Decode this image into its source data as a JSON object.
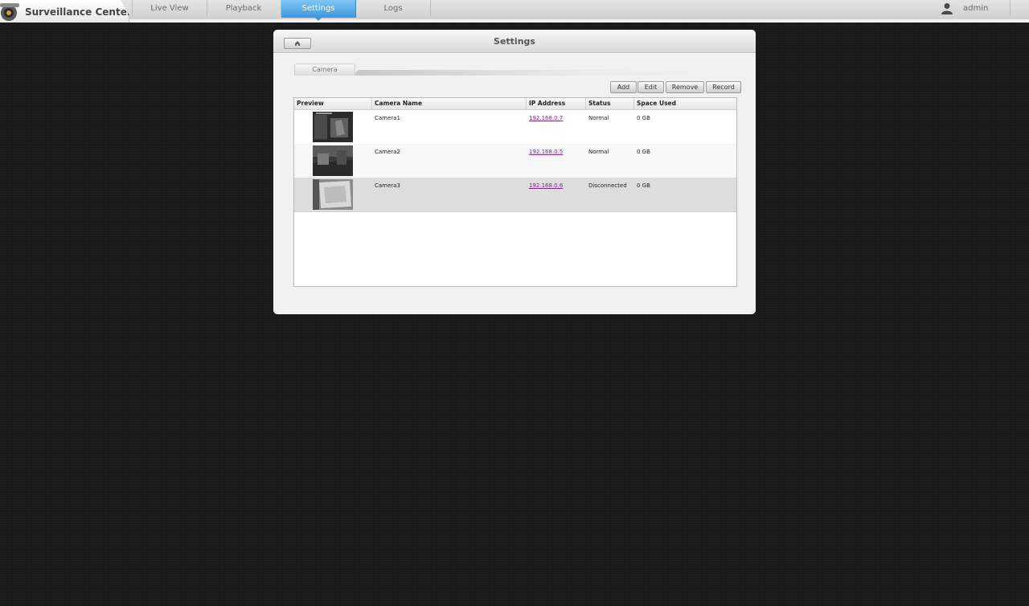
{
  "app": {
    "title": "Surveillance Center"
  },
  "nav": {
    "tabs": [
      {
        "label": "Live View"
      },
      {
        "label": "Playback"
      },
      {
        "label": "Settings",
        "active": true
      },
      {
        "label": "Logs"
      }
    ]
  },
  "user": {
    "name": "admin"
  },
  "panel": {
    "title": "Settings",
    "subtab": "Camera",
    "buttons": {
      "add": "Add",
      "edit": "Edit",
      "remove": "Remove",
      "record": "Record"
    }
  },
  "table": {
    "headers": {
      "preview": "Preview",
      "name": "Camera Name",
      "ip": "IP Address",
      "status": "Status",
      "space": "Space Used"
    },
    "rows": [
      {
        "name": "Camera1",
        "ip": "192.168.0.7",
        "status": "Normal",
        "space": "0 GB"
      },
      {
        "name": "Camera2",
        "ip": "192.168.0.5",
        "status": "Normal",
        "space": "0 GB"
      },
      {
        "name": "Camera3",
        "ip": "192.168.0.6",
        "status": "Disconnected",
        "space": "0 GB"
      }
    ]
  },
  "colors": {
    "accent": "#3b98dc",
    "link": "#7a2a8a",
    "background": "#181818"
  }
}
